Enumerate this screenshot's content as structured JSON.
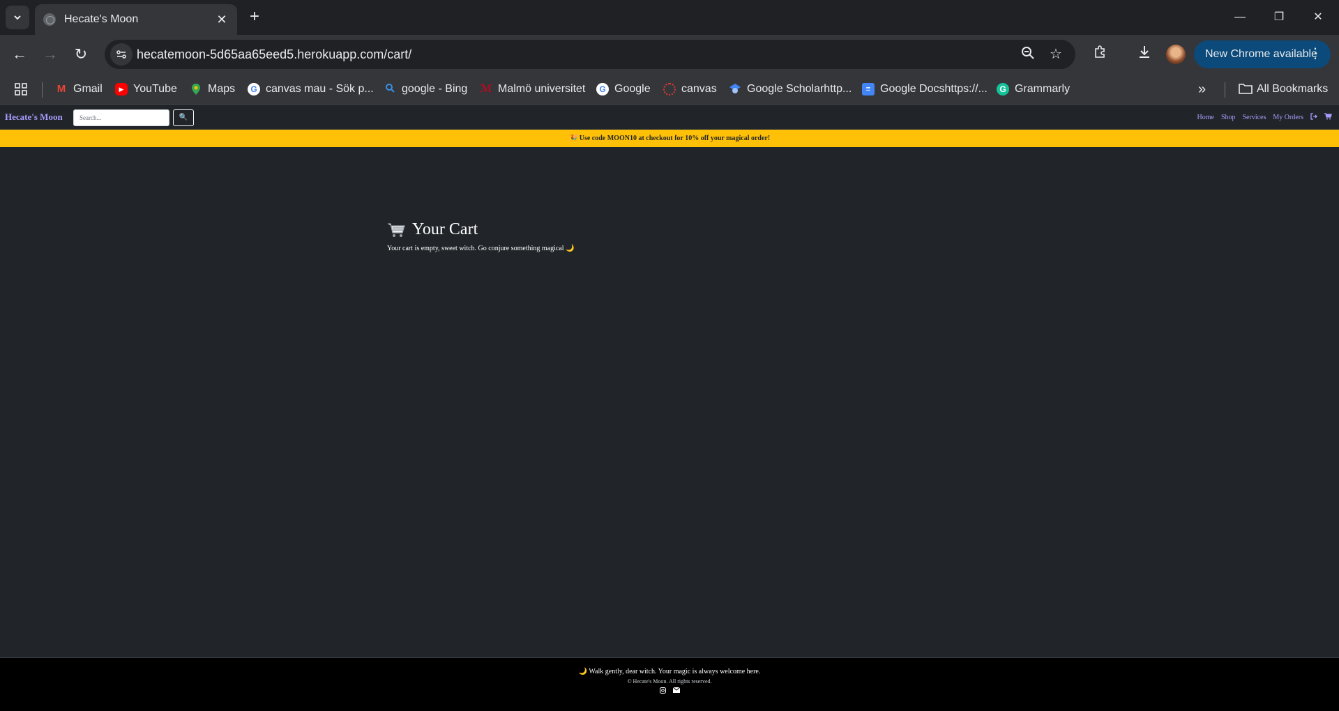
{
  "browser": {
    "tab": {
      "title": "Hecate's Moon"
    },
    "url": "hecatemoon-5d65aa65eed5.herokuapp.com/cart/",
    "update_button": "New Chrome available",
    "bookmarks": [
      {
        "label": "Gmail",
        "icon": "gmail-icon"
      },
      {
        "label": "YouTube",
        "icon": "youtube-icon"
      },
      {
        "label": "Maps",
        "icon": "maps-icon"
      },
      {
        "label": "canvas mau - Sök p...",
        "icon": "google-icon"
      },
      {
        "label": "google - Bing",
        "icon": "bing-search-icon"
      },
      {
        "label": "Malmö universitet",
        "icon": "mau-icon"
      },
      {
        "label": "Google",
        "icon": "google-icon"
      },
      {
        "label": "canvas",
        "icon": "canvas-icon"
      },
      {
        "label": "Google Scholarhttp...",
        "icon": "scholar-icon"
      },
      {
        "label": "Google Docshttps://...",
        "icon": "docs-icon"
      },
      {
        "label": "Grammarly",
        "icon": "grammarly-icon"
      }
    ],
    "all_bookmarks": "All Bookmarks"
  },
  "site": {
    "brand": "Hecate's Moon",
    "search": {
      "placeholder": "Search..."
    },
    "search_button_icon": "🔍",
    "nav": {
      "home": "Home",
      "shop": "Shop",
      "services": "Services",
      "orders": "My Orders"
    },
    "promo": "🎉 Use code MOON10 at checkout for 10% off your magical order!",
    "cart": {
      "title": "Your Cart",
      "empty_message": "Your cart is empty, sweet witch. Go conjure something magical 🌙"
    },
    "footer": {
      "tagline": "🌙 Walk gently, dear witch. Your magic is always welcome here.",
      "copyright": "© Hecate's Moon. All rights reserved."
    },
    "colors": {
      "brand": "#a99dff",
      "promo_bg": "#ffc107",
      "page_bg": "#212529",
      "footer_bg": "#000000"
    }
  }
}
